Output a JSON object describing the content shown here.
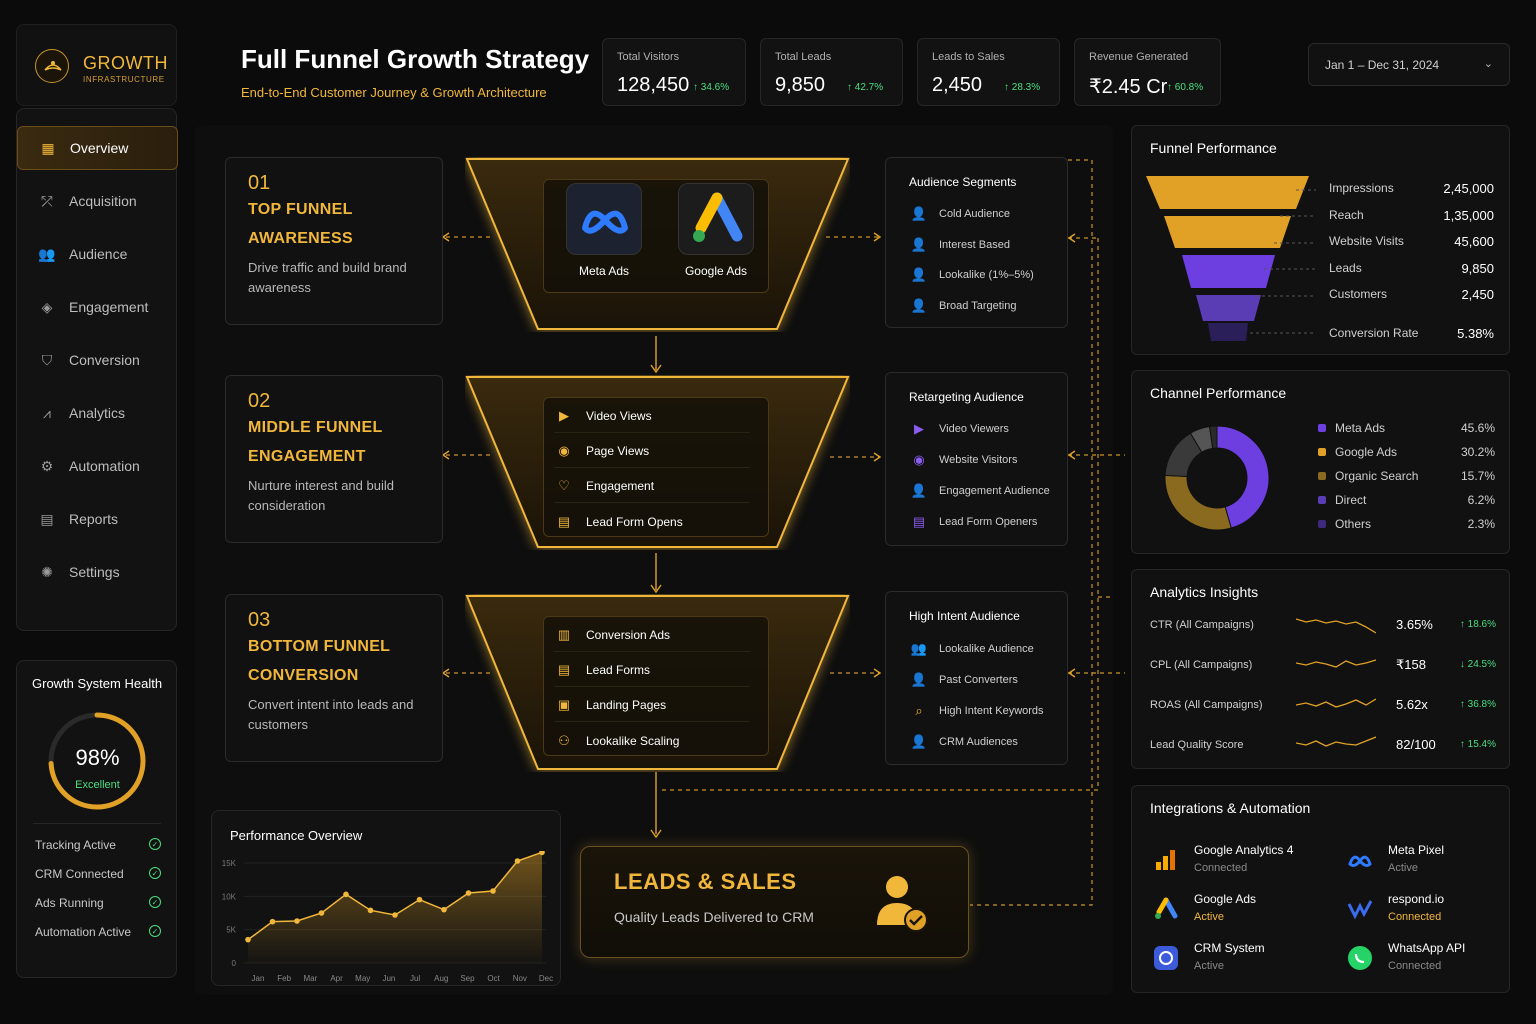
{
  "brand": {
    "name": "GROWTH",
    "tagline": "INFRASTRUCTURE"
  },
  "nav": [
    {
      "label": "Overview",
      "icon": "home-icon",
      "active": true
    },
    {
      "label": "Acquisition",
      "icon": "acquisition-icon"
    },
    {
      "label": "Audience",
      "icon": "audience-icon"
    },
    {
      "label": "Engagement",
      "icon": "engagement-icon"
    },
    {
      "label": "Conversion",
      "icon": "shield-icon"
    },
    {
      "label": "Analytics",
      "icon": "analytics-icon"
    },
    {
      "label": "Automation",
      "icon": "automation-icon"
    },
    {
      "label": "Reports",
      "icon": "reports-icon"
    },
    {
      "label": "Settings",
      "icon": "settings-icon"
    }
  ],
  "health": {
    "title": "Growth System Health",
    "score": "98%",
    "score_fraction": 0.98,
    "status": "Excellent",
    "items": [
      "Tracking Active",
      "CRM Connected",
      "Ads Running",
      "Automation Active"
    ]
  },
  "header": {
    "title": "Full Funnel Growth Strategy",
    "subtitle": "End-to-End Customer Journey & Growth Architecture",
    "date_range": "Jan 1 – Dec 31, 2024"
  },
  "kpis": [
    {
      "label": "Total Visitors",
      "value": "128,450",
      "change": "↑ 34.6%"
    },
    {
      "label": "Total Leads",
      "value": "9,850",
      "change": "↑ 42.7%"
    },
    {
      "label": "Leads to Sales",
      "value": "2,450",
      "change": "↑ 28.3%"
    },
    {
      "label": "Revenue Generated",
      "value": "₹2.45 Cr",
      "change": "↑ 60.8%"
    }
  ],
  "stages": [
    {
      "num": "01",
      "title1": "TOP FUNNEL",
      "title2": "AWARENESS",
      "desc": "Drive traffic and build brand awareness"
    },
    {
      "num": "02",
      "title1": "MIDDLE FUNNEL",
      "title2": "ENGAGEMENT",
      "desc": "Nurture interest and build consideration"
    },
    {
      "num": "03",
      "title1": "BOTTOM FUNNEL",
      "title2": "CONVERSION",
      "desc": "Convert intent into leads and customers"
    }
  ],
  "funnel_top": {
    "items": [
      "Meta Ads",
      "Google Ads"
    ]
  },
  "funnel_middle": {
    "items": [
      "Video Views",
      "Page Views",
      "Engagement",
      "Lead Form Opens"
    ]
  },
  "funnel_bottom": {
    "items": [
      "Conversion Ads",
      "Lead Forms",
      "Landing Pages",
      "Lookalike Scaling"
    ]
  },
  "audiences": [
    {
      "title": "Audience Segments",
      "items": [
        "Cold Audience",
        "Interest Based",
        "Lookalike (1%–5%)",
        "Broad Targeting"
      ]
    },
    {
      "title": "Retargeting Audience",
      "items": [
        "Video Viewers",
        "Website Visitors",
        "Engagement Audience",
        "Lead Form Openers"
      ]
    },
    {
      "title": "High Intent Audience",
      "items": [
        "Lookalike Audience",
        "Past Converters",
        "High Intent Keywords",
        "CRM Audiences"
      ]
    }
  ],
  "leads_box": {
    "title": "LEADS & SALES",
    "subtitle": "Quality Leads Delivered to CRM"
  },
  "performance_overview": {
    "title": "Performance Overview",
    "chart_data": {
      "type": "line",
      "x": [
        "Jan",
        "Feb",
        "Mar",
        "Apr",
        "May",
        "Jun",
        "Jul",
        "Aug",
        "Sep",
        "Oct",
        "Nov",
        "Dec"
      ],
      "values": [
        3500,
        6200,
        6300,
        7500,
        10300,
        7900,
        7200,
        9500,
        8000,
        10500,
        10800,
        15300,
        16600
      ],
      "ylim": [
        0,
        15000
      ],
      "yticks": [
        "0",
        "5K",
        "10K",
        "15K"
      ],
      "grid": true
    }
  },
  "funnel_performance": {
    "title": "Funnel Performance",
    "rows": [
      {
        "label": "Impressions",
        "value": "2,45,000"
      },
      {
        "label": "Reach",
        "value": "1,35,000"
      },
      {
        "label": "Website Visits",
        "value": "45,600"
      },
      {
        "label": "Leads",
        "value": "9,850"
      },
      {
        "label": "Customers",
        "value": "2,450"
      }
    ],
    "conversion_label": "Conversion Rate",
    "conversion_value": "5.38%"
  },
  "channel_performance": {
    "title": "Channel Performance",
    "chart_data": {
      "type": "pie",
      "categories": [
        "Meta Ads",
        "Google Ads",
        "Organic Search",
        "Direct",
        "Others"
      ],
      "values": [
        45.6,
        30.2,
        15.7,
        6.2,
        2.3
      ],
      "labels": [
        "45.6%",
        "30.2%",
        "15.7%",
        "6.2%",
        "2.3%"
      ],
      "colors": [
        "#6d3fe0",
        "#e0a126",
        "#8a6a1e",
        "#5a3cb4",
        "#3d2a7c"
      ]
    }
  },
  "analytics": {
    "title": "Analytics Insights",
    "rows": [
      {
        "label": "CTR (All Campaigns)",
        "value": "3.65%",
        "change": "↑ 18.6%",
        "dir": "up"
      },
      {
        "label": "CPL (All Campaigns)",
        "value": "₹158",
        "change": "↓ 24.5%",
        "dir": "down"
      },
      {
        "label": "ROAS (All Campaigns)",
        "value": "5.62x",
        "change": "↑ 36.8%",
        "dir": "up"
      },
      {
        "label": "Lead Quality Score",
        "value": "82/100",
        "change": "↑ 15.4%",
        "dir": "up"
      }
    ]
  },
  "integrations": {
    "title": "Integrations & Automation",
    "items": [
      {
        "name": "Google Analytics 4",
        "status": "Connected",
        "icon": "google-analytics-icon"
      },
      {
        "name": "Meta Pixel",
        "status": "Active",
        "icon": "meta-pixel-icon"
      },
      {
        "name": "Google Ads",
        "status": "Active",
        "icon": "google-ads-icon"
      },
      {
        "name": "respond.io",
        "status": "Connected",
        "icon": "respondio-icon"
      },
      {
        "name": "CRM System",
        "status": "Active",
        "icon": "crm-icon"
      },
      {
        "name": "WhatsApp API",
        "status": "Connected",
        "icon": "whatsapp-icon"
      }
    ]
  },
  "colors": {
    "accent": "#f1b73a",
    "positive": "#4ade80",
    "purple": "#6d3fe0"
  }
}
